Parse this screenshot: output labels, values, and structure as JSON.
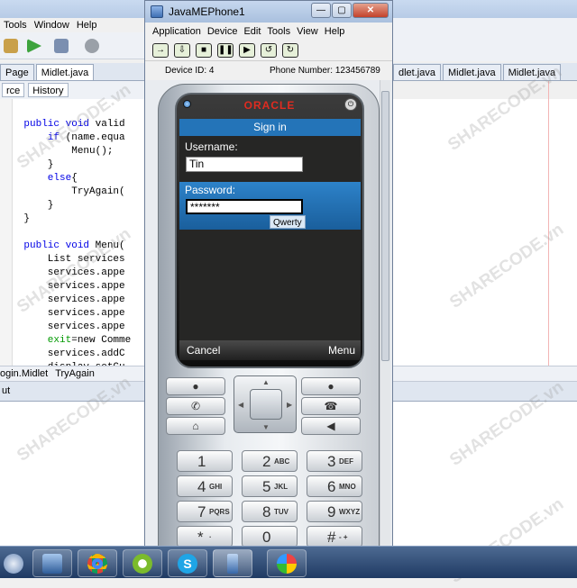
{
  "ide": {
    "menu": [
      "Tools",
      "Window",
      "Help"
    ],
    "editor_tabs_left": [
      "Page",
      "Midlet.java"
    ],
    "editor_tabs_right": [
      "dlet.java",
      "Midlet.java",
      "Midlet.java"
    ],
    "source_tabs": [
      "rce",
      "History"
    ],
    "code_lines": [
      {
        "kw": "    public void ",
        "rest": "valid"
      },
      {
        "kw": "        if ",
        "rest": "(name.equa"
      },
      {
        "kw": "",
        "rest": "            Menu();"
      },
      {
        "kw": "",
        "rest": "        }"
      },
      {
        "kw": "        else",
        "rest": "{"
      },
      {
        "kw": "",
        "rest": "            TryAgain("
      },
      {
        "kw": "",
        "rest": "        }"
      },
      {
        "kw": "",
        "rest": "    }"
      },
      {
        "kw": "",
        "rest": ""
      },
      {
        "kw": "    public void ",
        "rest": "Menu("
      },
      {
        "kw": "",
        "rest": "        List services"
      },
      {
        "kw": "",
        "rest": "        services.appe"
      },
      {
        "kw": "",
        "rest": "        services.appe"
      },
      {
        "kw": "",
        "rest": "        services.appe"
      },
      {
        "kw": "",
        "rest": "        services.appe"
      },
      {
        "kw": "",
        "rest": "        services.appe"
      },
      {
        "kw": "        exit",
        "rest": "=new Comme"
      },
      {
        "kw": "",
        "rest": "        services.addC"
      },
      {
        "kw": "",
        "rest": "        display.setCu"
      }
    ],
    "breadcrumb": [
      "ogin.Midlet",
      "TryAgain"
    ],
    "output_tab": "ut"
  },
  "emulator": {
    "window_title": "JavaMEPhone1",
    "menu": [
      "Application",
      "Device",
      "Edit",
      "Tools",
      "View",
      "Help"
    ],
    "device_id_label": "Device ID: 4",
    "phone_number_label": "Phone Number: 123456789",
    "brand": "ORACLE",
    "screen": {
      "title": "Sign in",
      "username_label": "Username:",
      "username_value": "Tin",
      "password_label": "Password:",
      "password_value": "*******",
      "input_mode": "Qwerty",
      "soft_left": "Cancel",
      "soft_right": "Menu"
    },
    "keys": [
      {
        "digit": "1",
        "letters": ""
      },
      {
        "digit": "2",
        "letters": "ABC"
      },
      {
        "digit": "3",
        "letters": "DEF"
      },
      {
        "digit": "4",
        "letters": "GHI"
      },
      {
        "digit": "5",
        "letters": "JKL"
      },
      {
        "digit": "6",
        "letters": "MNO"
      },
      {
        "digit": "7",
        "letters": "PQRS"
      },
      {
        "digit": "8",
        "letters": "TUV"
      },
      {
        "digit": "9",
        "letters": "WXYZ"
      },
      {
        "digit": "*",
        "letters": "·"
      },
      {
        "digit": "0",
        "letters": ""
      },
      {
        "digit": "#",
        "letters": "- +"
      }
    ]
  },
  "watermark": "SHARECODE.vn",
  "colors": {
    "screen_header": "#2474b8",
    "brand": "#e02b20",
    "keyword": "#0000e6"
  },
  "taskbar_icons": [
    "start-orb-icon",
    "virtualbox-icon",
    "chrome-icon",
    "coreldraw-icon",
    "skype-icon",
    "phone-emulator-icon",
    "paint-icon"
  ]
}
